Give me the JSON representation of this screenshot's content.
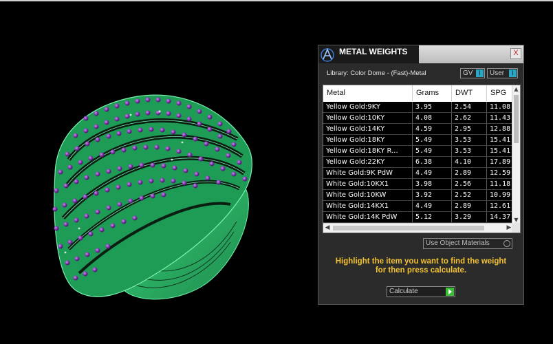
{
  "panel": {
    "title": "METAL WEIGHTS",
    "close_label": "X",
    "library_label": "Library: Color Dome - (Fast)-Metal",
    "toggles": [
      {
        "label": "GV",
        "switch_label": "I"
      },
      {
        "label": "User",
        "switch_label": "I"
      }
    ],
    "table": {
      "columns": [
        "Metal",
        "Grams",
        "DWT",
        "SPG"
      ],
      "rows": [
        [
          "Yellow Gold:9KY",
          "3.95",
          "2.54",
          "11.08"
        ],
        [
          "Yellow Gold:10KY",
          "4.08",
          "2.62",
          "11.43"
        ],
        [
          "Yellow Gold:14KY",
          "4.59",
          "2.95",
          "12.88"
        ],
        [
          "Yellow Gold:18KY",
          "5.49",
          "3.53",
          "15.41"
        ],
        [
          "Yellow Gold:18KY R...",
          "5.49",
          "3.53",
          "15.41"
        ],
        [
          "Yellow Gold:22KY",
          "6.38",
          "4.10",
          "17.89"
        ],
        [
          "White Gold:9K PdW",
          "4.49",
          "2.89",
          "12.59"
        ],
        [
          "White Gold:10KX1",
          "3.98",
          "2.56",
          "11.18"
        ],
        [
          "White Gold:10KW",
          "3.92",
          "2.52",
          "10.99"
        ],
        [
          "White Gold:14KX1",
          "4.49",
          "2.89",
          "12.61"
        ],
        [
          "White Gold:14K PdW",
          "5.12",
          "3.29",
          "14.37"
        ]
      ]
    },
    "use_object_materials_label": "Use Object Materials",
    "hint_line1": "Highlight the item you want to find the weight",
    "hint_line2": "for then press calculate.",
    "calculate_label": "Calculate"
  },
  "colors": {
    "background": "#000000",
    "ring_wire": "#2fbf6a",
    "gems": "#7a2fa8",
    "hint_text": "#f2c12e",
    "toggle_accent": "#2aa6c3"
  }
}
